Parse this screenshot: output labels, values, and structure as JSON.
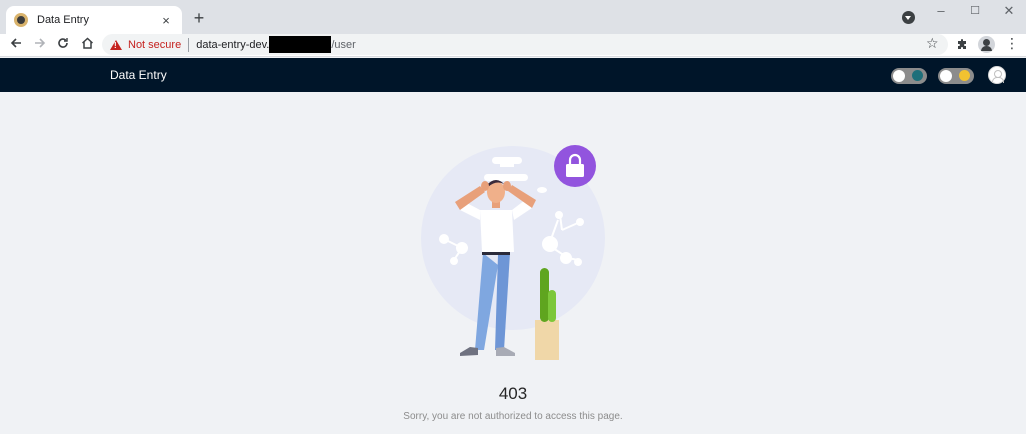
{
  "browser": {
    "tab_title": "Data Entry",
    "tab_close": "×",
    "new_tab": "+",
    "not_secure": "Not secure",
    "url_domain": "data-entry-dev.",
    "url_path": "/user",
    "window_controls": {
      "minimize": "–",
      "maximize": "☐",
      "close": "✕"
    },
    "icons": {
      "back": "back-arrow-icon",
      "forward": "forward-arrow-icon",
      "reload": "reload-icon",
      "home": "home-icon",
      "star": "star-icon",
      "extensions": "puzzle-icon",
      "account": "account-icon",
      "menu": "kebab-menu-icon"
    }
  },
  "header": {
    "title": "Data Entry",
    "background": "#001529"
  },
  "result": {
    "status": "403",
    "message": "Sorry, you are not authorized to access this page.",
    "accent_color": "#9254de"
  }
}
